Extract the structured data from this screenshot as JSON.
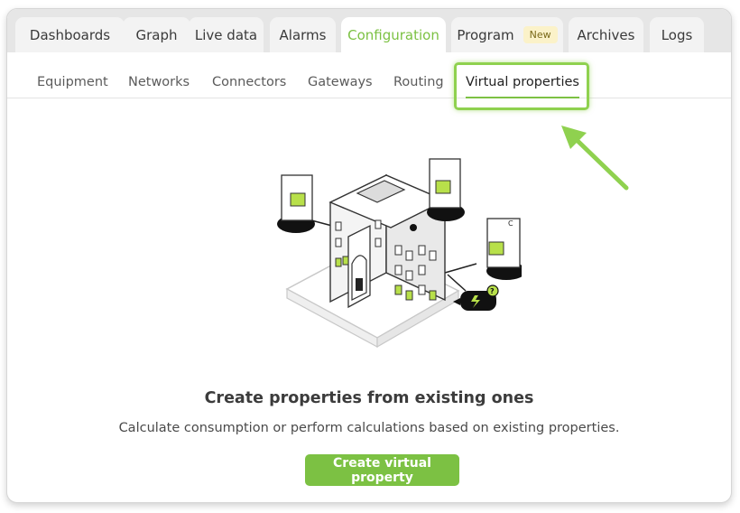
{
  "tabs": [
    {
      "label": "Dashboards"
    },
    {
      "label": "Graph"
    },
    {
      "label": "Live data"
    },
    {
      "label": "Alarms"
    },
    {
      "label": "Configuration",
      "active": true
    },
    {
      "label": "Program",
      "badge": "New"
    },
    {
      "label": "Archives"
    },
    {
      "label": "Logs"
    }
  ],
  "subtabs": [
    {
      "label": "Equipment"
    },
    {
      "label": "Networks"
    },
    {
      "label": "Connectors"
    },
    {
      "label": "Gateways"
    },
    {
      "label": "Routing"
    },
    {
      "label": "Virtual properties",
      "active": true
    }
  ],
  "empty_state": {
    "heading": "Create properties from existing ones",
    "description": "Calculate consumption or perform calculations based on existing properties.",
    "button_label": "Create virtual property"
  },
  "illustration": {
    "meter_letter": "C",
    "bubble_symbol": "?"
  },
  "colors": {
    "accent": "#7cc143",
    "highlight": "#8fd14f",
    "badge_bg": "#fbf2c9"
  }
}
